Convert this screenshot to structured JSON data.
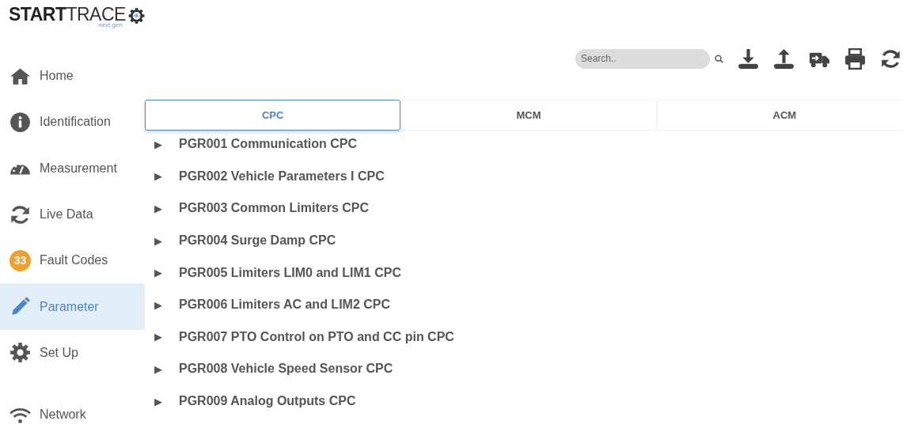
{
  "brand": {
    "bold": "START",
    "light": "TRACE",
    "tagline": "next gen"
  },
  "sidebar": {
    "items": [
      {
        "label": "Home",
        "selected": false
      },
      {
        "label": "Identification",
        "selected": false
      },
      {
        "label": "Measurement",
        "selected": false
      },
      {
        "label": "Live Data",
        "selected": false
      },
      {
        "label": "Fault Codes",
        "selected": false,
        "badge": "33"
      },
      {
        "label": "Parameter",
        "selected": true
      },
      {
        "label": "Set Up",
        "selected": false
      }
    ],
    "bottom_item": {
      "label": "Network",
      "selected": false
    }
  },
  "search": {
    "placeholder": "Search.."
  },
  "tabs": [
    {
      "label": "CPC",
      "selected": true
    },
    {
      "label": "MCM",
      "selected": false
    },
    {
      "label": "ACM",
      "selected": false
    }
  ],
  "groups": [
    {
      "arrow": "▶",
      "label": "PGR001 Communication CPC"
    },
    {
      "arrow": "▶",
      "label": "PGR002 Vehicle Parameters I CPC"
    },
    {
      "arrow": "▶",
      "label": "PGR003 Common Limiters CPC"
    },
    {
      "arrow": "▶",
      "label": "PGR004 Surge Damp CPC"
    },
    {
      "arrow": "▶",
      "label": "PGR005 Limiters LIM0 and LIM1 CPC"
    },
    {
      "arrow": "▶",
      "label": "PGR006 Limiters AC and LIM2 CPC"
    },
    {
      "arrow": "▶",
      "label": "PGR007 PTO Control on PTO and CC pin CPC"
    },
    {
      "arrow": "▶",
      "label": "PGR008 Vehicle Speed Sensor CPC"
    },
    {
      "arrow": "▶",
      "label": "PGR009 Analog Outputs CPC"
    }
  ]
}
